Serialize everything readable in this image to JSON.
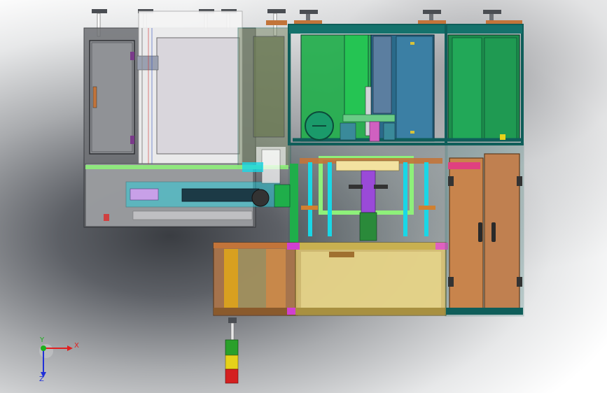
{
  "viewport": {
    "background": "gradient-gray"
  },
  "colors": {
    "frame": "#0f5e5a",
    "orange": "#c2743a",
    "panel_green": "#1f9a55",
    "panel_blue": "#2a6a8a",
    "cyan": "#19d7e6",
    "yellow": "#d8c070",
    "brown": "#a9744b",
    "gray_cabinet": "#7a7c80",
    "light_panel": "#d9d6dc",
    "lime": "#8ef07a",
    "magenta": "#e040b8",
    "signal_red": "#d42020",
    "signal_yellow": "#e6d21a",
    "signal_green": "#2aa02a"
  },
  "triad": {
    "x_label": "X",
    "y_label": "Y",
    "z_label": "Z",
    "x_color": "#e02020",
    "y_color": "#1cb01c",
    "z_color": "#2030d8"
  },
  "icons": {
    "triad": "coordinate-triad-icon",
    "signal_tower": "signal-tower-icon",
    "door_handle": "door-handle-icon",
    "gauge": "pressure-gauge-icon"
  }
}
